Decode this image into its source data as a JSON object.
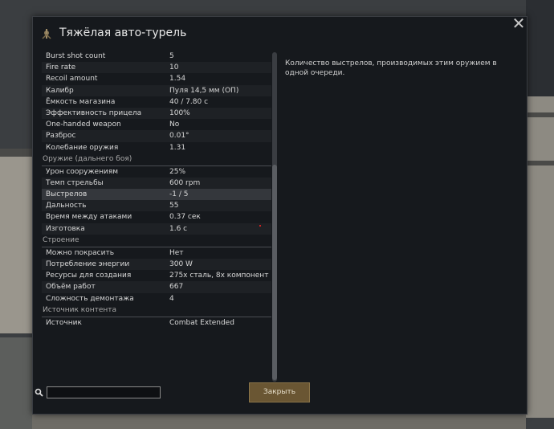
{
  "dialog": {
    "title": "Тяжёлая авто-турель",
    "title_icon": "turret-icon",
    "close_icon": "close-icon"
  },
  "stats": [
    {
      "type": "row",
      "label": "Burst shot count",
      "value": "5"
    },
    {
      "type": "row",
      "label": "Fire rate",
      "value": "10"
    },
    {
      "type": "row",
      "label": "Recoil amount",
      "value": "1.54"
    },
    {
      "type": "row",
      "label": "Калибр",
      "value": "Пуля 14,5 мм (ОП)"
    },
    {
      "type": "row",
      "label": "Ёмкость магазина",
      "value": "40 / 7.80 с"
    },
    {
      "type": "row",
      "label": "Эффективность прицела",
      "value": "100%"
    },
    {
      "type": "row",
      "label": "One-handed weapon",
      "value": "No"
    },
    {
      "type": "row",
      "label": "Разброс",
      "value": "0.01°"
    },
    {
      "type": "row",
      "label": "Колебание оружия",
      "value": "1.31"
    },
    {
      "type": "category",
      "label": "Оружие (дальнего боя)"
    },
    {
      "type": "row",
      "label": "Урон сооружениям",
      "value": "25%"
    },
    {
      "type": "row",
      "label": "Темп стрельбы",
      "value": "600 rpm"
    },
    {
      "type": "row",
      "label": "Выстрелов",
      "value": "-1 / 5",
      "highlight": true
    },
    {
      "type": "row",
      "label": "Дальность",
      "value": "55"
    },
    {
      "type": "row",
      "label": "Время между атаками",
      "value": "0.37 сек"
    },
    {
      "type": "row",
      "label": "Изготовка",
      "value": "1.6 с"
    },
    {
      "type": "category",
      "label": "Строение"
    },
    {
      "type": "row",
      "label": "Можно покрасить",
      "value": "Нет"
    },
    {
      "type": "row",
      "label": "Потребление энергии",
      "value": "300 W"
    },
    {
      "type": "row",
      "label": "Ресурсы для создания",
      "value": "275x сталь, 8x компонент"
    },
    {
      "type": "row",
      "label": "Объём работ",
      "value": "667"
    },
    {
      "type": "row",
      "label": "Сложность демонтажа",
      "value": "4"
    },
    {
      "type": "category",
      "label": "Источник контента"
    },
    {
      "type": "row",
      "label": "Источник",
      "value": "Combat Extended"
    }
  ],
  "description": "Количество выстрелов, производимых этим оружием в одной очереди.",
  "search": {
    "value": "",
    "icon": "search-icon"
  },
  "buttons": {
    "close_label": "Закрыть"
  }
}
